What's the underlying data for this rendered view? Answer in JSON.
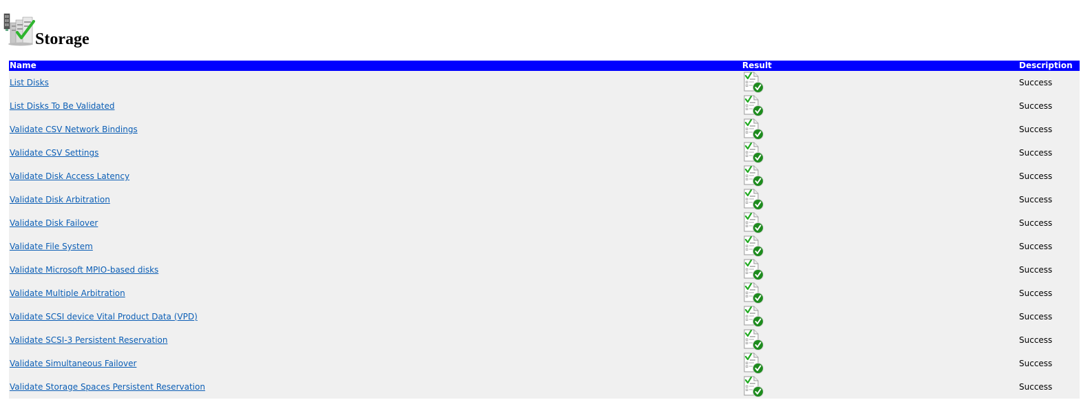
{
  "page": {
    "title": "Storage",
    "icon": "storage-server-check-icon"
  },
  "table": {
    "headers": {
      "name": "Name",
      "result": "Result",
      "description": "Description"
    },
    "rows": [
      {
        "name": "List Disks",
        "result_icon": "success-report-icon",
        "description": "Success"
      },
      {
        "name": "List Disks To Be Validated",
        "result_icon": "success-report-icon",
        "description": "Success"
      },
      {
        "name": "Validate CSV Network Bindings",
        "result_icon": "success-report-icon",
        "description": "Success"
      },
      {
        "name": "Validate CSV Settings",
        "result_icon": "success-report-icon",
        "description": "Success"
      },
      {
        "name": "Validate Disk Access Latency",
        "result_icon": "success-report-icon",
        "description": "Success"
      },
      {
        "name": "Validate Disk Arbitration",
        "result_icon": "success-report-icon",
        "description": "Success"
      },
      {
        "name": "Validate Disk Failover",
        "result_icon": "success-report-icon",
        "description": "Success"
      },
      {
        "name": "Validate File System",
        "result_icon": "success-report-icon",
        "description": "Success"
      },
      {
        "name": "Validate Microsoft MPIO-based disks",
        "result_icon": "success-report-icon",
        "description": "Success"
      },
      {
        "name": "Validate Multiple Arbitration",
        "result_icon": "success-report-icon",
        "description": "Success"
      },
      {
        "name": "Validate SCSI device Vital Product Data (VPD)",
        "result_icon": "success-report-icon",
        "description": "Success"
      },
      {
        "name": "Validate SCSI-3 Persistent Reservation",
        "result_icon": "success-report-icon",
        "description": "Success"
      },
      {
        "name": "Validate Simultaneous Failover",
        "result_icon": "success-report-icon",
        "description": "Success"
      },
      {
        "name": "Validate Storage Spaces Persistent Reservation",
        "result_icon": "success-report-icon",
        "description": "Success"
      }
    ]
  },
  "colors": {
    "header_bg": "#0000ff",
    "header_text": "#ffffff",
    "row_bg": "#f0f0f0",
    "link": "#0b5eb5",
    "success_green": "#2e9e2e"
  }
}
